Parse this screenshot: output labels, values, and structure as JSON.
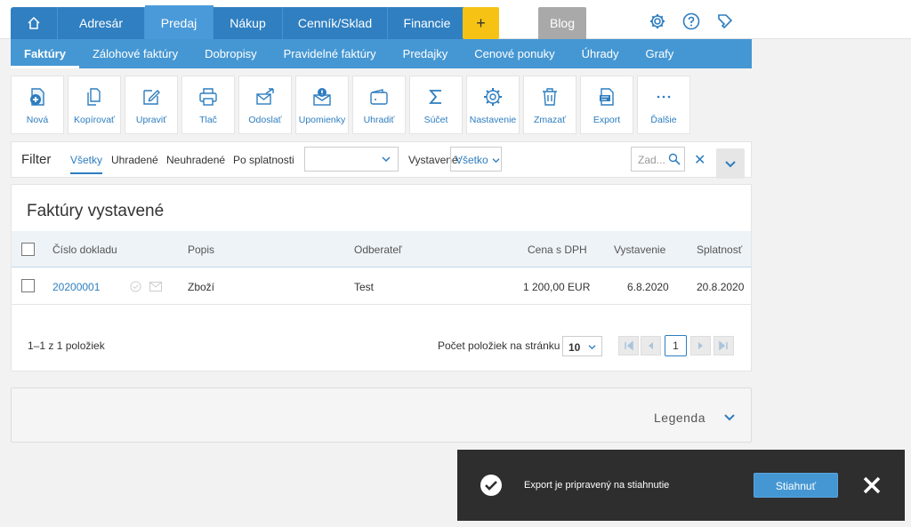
{
  "nav": {
    "tabs": [
      "Adresár",
      "Predaj",
      "Nákup",
      "Cenník/Sklad",
      "Financie"
    ],
    "plus_label": "+",
    "blog_label": "Blog",
    "home_icon": "home-icon",
    "right_icons": [
      "gear-icon",
      "help-icon",
      "notification-icon"
    ]
  },
  "subnav": {
    "items": [
      "Faktúry",
      "Zálohové faktúry",
      "Dobropisy",
      "Pravidelné faktúry",
      "Predajky",
      "Cenové ponuky",
      "Úhrady",
      "Grafy"
    ]
  },
  "toolbar": {
    "items": [
      {
        "label": "Nová",
        "icon": "add-document-icon"
      },
      {
        "label": "Kopírovať",
        "icon": "copy-icon"
      },
      {
        "label": "Upraviť",
        "icon": "edit-icon"
      },
      {
        "label": "Tlač",
        "icon": "print-icon"
      },
      {
        "label": "Odoslať",
        "icon": "send-icon"
      },
      {
        "label": "Upomienky",
        "icon": "reminder-icon"
      },
      {
        "label": "Uhradiť",
        "icon": "wallet-icon"
      },
      {
        "label": "Súčet",
        "icon": "sum-icon"
      },
      {
        "label": "Nastavenie",
        "icon": "gear-icon"
      },
      {
        "label": "Zmazať",
        "icon": "trash-icon"
      },
      {
        "label": "Export",
        "icon": "export-icon"
      },
      {
        "label": "Ďalšie",
        "icon": "more-icon"
      }
    ]
  },
  "filter": {
    "title": "Filter",
    "options": [
      "Všetky",
      "Uhradené",
      "Neuhradené",
      "Po splatnosti"
    ],
    "select_value": "",
    "vystavene_label": "Vystavené:",
    "vystavene_value": "Všetko",
    "search_placeholder": "Zad..."
  },
  "main": {
    "title": "Faktúry vystavené",
    "columns": [
      "Číslo dokladu",
      "Popis",
      "Odberateľ",
      "Cena s DPH",
      "Vystavenie",
      "Splatnosť"
    ],
    "rows": [
      {
        "cislo": "20200001",
        "popis": "Zboží",
        "odberatel": "Test",
        "cena": "1 200,00 EUR",
        "vystavenie": "6.8.2020",
        "splatnost": "20.8.2020"
      }
    ],
    "pager_info": "1–1 z 1 položiek",
    "per_page_label": "Počet položiek na stránku",
    "per_page_value": "10",
    "current_page": "1"
  },
  "legend": {
    "label": "Legenda"
  },
  "toast": {
    "message": "Export je pripravený na stiahnutie",
    "button_label": "Stiahnuť"
  },
  "colors": {
    "primary": "#2f7fc1",
    "subnav": "#4597d3",
    "accent_yellow": "#f6c315",
    "link": "#2d7dbf"
  }
}
